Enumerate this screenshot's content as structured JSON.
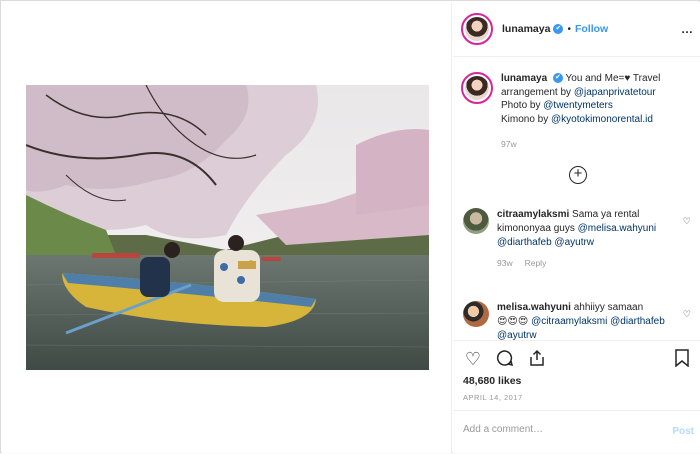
{
  "author": {
    "username": "lunamaya",
    "verified_mark": "✔",
    "separator": "•",
    "follow_label": "Follow",
    "more_icon": "…"
  },
  "caption": {
    "username": "lunamaya",
    "parts": {
      "t1": "You and Me=",
      "heart": "♥",
      "t2": " Travel arrangement by ",
      "m1": "@japanprivatetour",
      "t3": "Photo by ",
      "m2": "@twentymeters",
      "t4": "Kimono by ",
      "m3": "@kyotokimonorental.id"
    },
    "time": "97w"
  },
  "load_more_icon": "+",
  "comments": [
    {
      "username": "citraamylaksmi",
      "text": " Sama ya rental kimononyaa guys ",
      "mentions": [
        "@melisa.wahyuni",
        "@diarthafeb",
        "@ayutrw"
      ],
      "age": "93w",
      "reply_label": "Reply"
    },
    {
      "username": "melisa.wahyuni",
      "text": " ahhiiyy samaan ",
      "emoji": "😍😍😍",
      "mentions": [
        "@citraamylaksmi",
        "@diarthafeb",
        "@ayutrw"
      ]
    }
  ],
  "likes": "48,680 likes",
  "date": "APRIL 14, 2017",
  "add_comment_placeholder": "Add a comment…",
  "post_label": "Post",
  "colors": {
    "link": "#003569",
    "follow": "#3897f0",
    "post_disabled": "#b3dbff"
  }
}
